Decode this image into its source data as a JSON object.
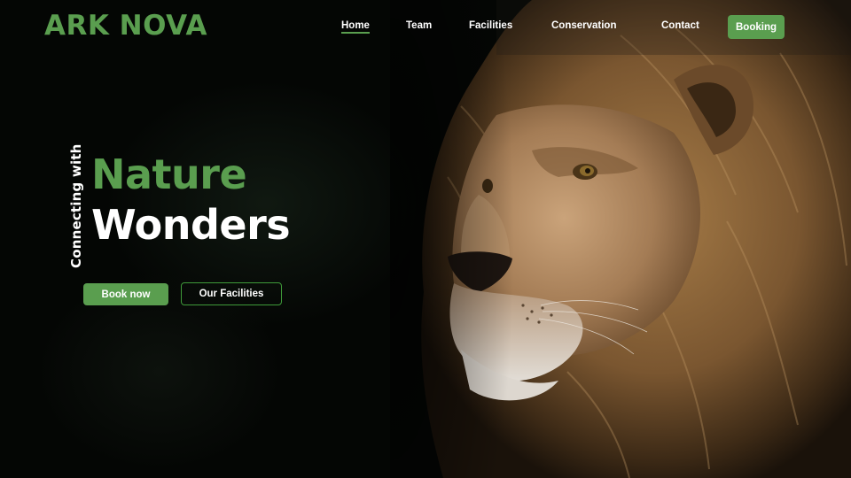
{
  "brand": {
    "name": "ARK NOVA"
  },
  "nav": {
    "items": [
      {
        "label": "Home",
        "active": true
      },
      {
        "label": "Team",
        "active": false
      },
      {
        "label": "Facilities",
        "active": false
      },
      {
        "label": "Conservation",
        "active": false
      },
      {
        "label": "Contact",
        "active": false
      }
    ],
    "cta_label": "Booking"
  },
  "hero": {
    "tagline": "Connecting with",
    "headline_accent": "Nature",
    "headline_main": "Wonders",
    "primary_button": "Book now",
    "secondary_button": "Our Facilities",
    "image_subject": "lion"
  },
  "colors": {
    "brand_green": "#5a9e4f",
    "outline_green": "#3f9b3a",
    "background": "#040604",
    "text": "#ffffff"
  }
}
